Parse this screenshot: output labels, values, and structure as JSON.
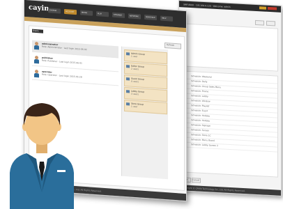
{
  "back_window": {
    "top_text": "SMP-8000 · 192.168.0.120 · Welcome: admin",
    "rows": [
      "Schedule: Weekend",
      "Schedule: Daily",
      "Schedule: Group Sales Menu",
      "Schedule: Promo",
      "Schedule: Lobby",
      "Schedule: Window",
      "Schedule: Playlist",
      "Schedule: Event",
      "Schedule: Holiday",
      "Schedule: Holiday",
      "Schedule: Signage",
      "Schedule: Screen",
      "Schedule: Store 1C",
      "Schedule: Menu Board",
      "Schedule: Lobby Screen 2"
    ],
    "bottom_buttons": [
      "Save",
      "Cancel"
    ],
    "footer": "Copyright © CAYIN Technology Co., Ltd. All Rights Reserved."
  },
  "front_window": {
    "logo": "cayin",
    "tabs": [
      "SYSTEM",
      "ACCOUNT",
      "MEDIA",
      "PLAY",
      "STORAGE",
      "NETWORK",
      "SCHEDULE",
      "HELP"
    ],
    "active_tab_index": 1,
    "section_label": "Users",
    "refresh_button": "Refresh",
    "users": [
      {
        "name": "administrator",
        "desc": "Role: Administrator · Last login 2015-06-02"
      },
      {
        "name": "publisher",
        "desc": "Role: Publisher · Last login 2015-06-01"
      },
      {
        "name": "operator",
        "desc": "Role: Operator · Last login 2015-05-28"
      }
    ],
    "groups": [
      {
        "title": "Admin Group",
        "sub": "1 user"
      },
      {
        "title": "Editor Group",
        "sub": "2 users"
      },
      {
        "title": "Guest Group",
        "sub": "0 users"
      },
      {
        "title": "Lobby Group",
        "sub": "3 users"
      },
      {
        "title": "Store Group",
        "sub": "1 user"
      }
    ],
    "footer": "Copyright © CAYIN Technology Co., Ltd. All Rights Reserved."
  },
  "colors": {
    "topbar": "#2e2e2e",
    "accent": "#c08a2c",
    "group_bg": "#f3e3c3",
    "avatar_suit": "#2a6e9b",
    "avatar_skin": "#f2c586",
    "avatar_hair": "#3a2418"
  },
  "avatar_icon": "user-avatar-icon"
}
